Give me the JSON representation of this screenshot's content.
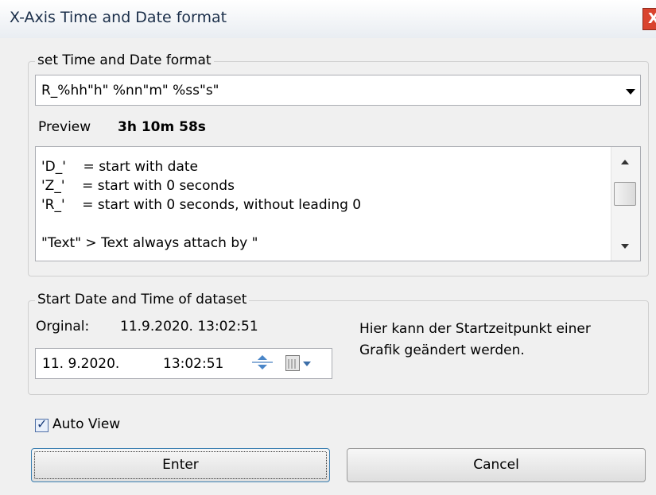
{
  "window": {
    "title": "X-Axis Time and Date format",
    "close_glyph": "X"
  },
  "format_group": {
    "legend": "set Time and Date format",
    "format_value": "R_%hh\"h\" %nn\"m\" %ss\"s\"",
    "preview_label": "Preview",
    "preview_value": "3h 10m 58s",
    "help_lines": [
      "'D_'    = start with date",
      "'Z_'    = start with 0 seconds",
      "'R_'    = start with 0 seconds, without leading 0",
      "",
      "\"Text\" > Text always attach by \""
    ]
  },
  "start_group": {
    "legend": "Start Date and Time of dataset",
    "original_label": "Orginal:",
    "original_value": "11.9.2020. 13:02:51",
    "hint": "Hier kann der Startzeitpunkt einer Grafik geändert werden.",
    "date_value": "11.  9.2020.",
    "time_value": "13:02:51"
  },
  "auto_view": {
    "label": "Auto View",
    "checked": true
  },
  "buttons": {
    "enter": "Enter",
    "cancel": "Cancel"
  }
}
